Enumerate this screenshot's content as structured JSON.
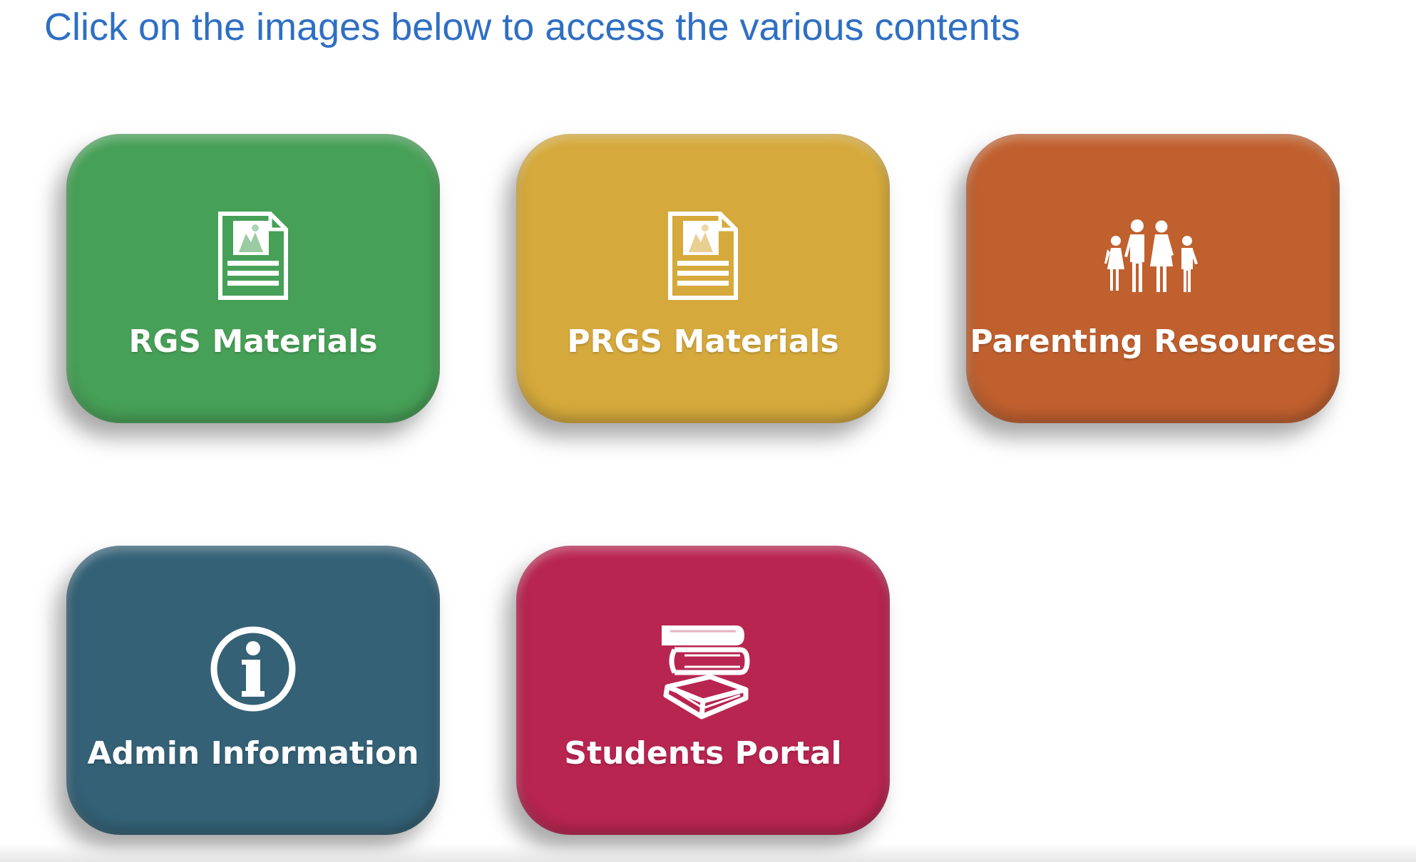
{
  "heading": {
    "text": "Click on the images below to access the various contents",
    "color": "#2f6fc4"
  },
  "tiles": [
    {
      "id": "rgs",
      "label": "RGS Materials",
      "icon": "document-icon",
      "color": "#47a057"
    },
    {
      "id": "prgs",
      "label": "PRGS Materials",
      "icon": "document-icon",
      "color": "#d5a93b"
    },
    {
      "id": "parenting",
      "label": "Parenting Resources",
      "icon": "family-icon",
      "color": "#c0602f"
    },
    {
      "id": "admin",
      "label": "Admin Information",
      "icon": "info-icon",
      "color": "#346176"
    },
    {
      "id": "students",
      "label": "Students Portal",
      "icon": "books-icon",
      "color": "#b82551"
    }
  ]
}
